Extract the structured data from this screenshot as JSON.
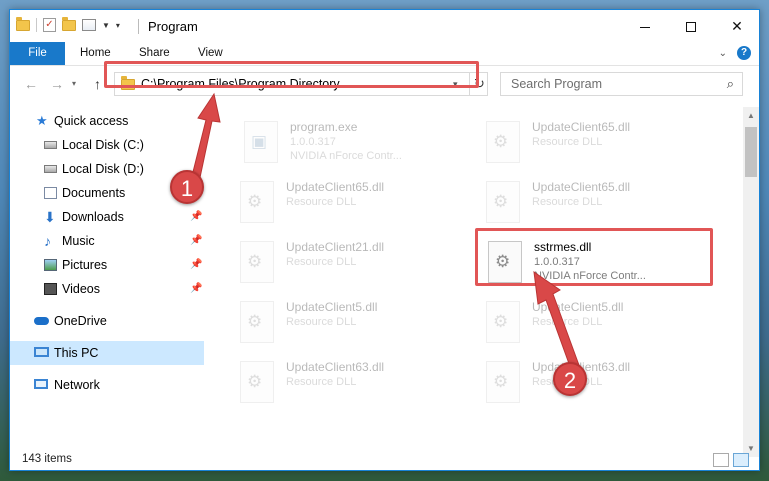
{
  "window": {
    "title": "Program",
    "buttons": {
      "minimize": "minimize",
      "maximize": "maximize",
      "close": "✕"
    }
  },
  "ribbon": {
    "tabs": [
      "File",
      "Home",
      "Share",
      "View"
    ]
  },
  "navigation": {
    "address": "C:\\Program Files\\Program Directory",
    "search_placeholder": "Search Program"
  },
  "sidebar": {
    "items": [
      {
        "label": "Quick access",
        "icon": "star-icon"
      },
      {
        "label": "Local Disk (C:)",
        "icon": "drive-icon"
      },
      {
        "label": "Local Disk (D:)",
        "icon": "drive-icon"
      },
      {
        "label": "Documents",
        "icon": "documents-icon"
      },
      {
        "label": "Downloads",
        "icon": "download-icon",
        "pinned": true
      },
      {
        "label": "Music",
        "icon": "music-icon",
        "pinned": true
      },
      {
        "label": "Pictures",
        "icon": "pictures-icon",
        "pinned": true
      },
      {
        "label": "Videos",
        "icon": "videos-icon",
        "pinned": true
      },
      {
        "label": "OneDrive",
        "icon": "cloud-icon"
      },
      {
        "label": "This PC",
        "icon": "computer-icon",
        "selected": true
      },
      {
        "label": "Network",
        "icon": "network-icon"
      }
    ]
  },
  "files": [
    {
      "name": "program.exe",
      "line1": "1.0.0.317",
      "line2": "NVIDIA nForce Contr..."
    },
    {
      "name": "UpdateClient65.dll",
      "line1": "Resource DLL"
    },
    {
      "name": "UpdateClient65.dll",
      "line1": "Resource DLL"
    },
    {
      "name": "UpdateClient65.dll",
      "line1": "Resource DLL"
    },
    {
      "name": "UpdateClient21.dll",
      "line1": "Resource DLL"
    },
    {
      "name": "sstrmes.dll",
      "line1": "1.0.0.317",
      "line2": "NVIDIA nForce Contr..."
    },
    {
      "name": "UpdateClient5.dll",
      "line1": "Resource DLL"
    },
    {
      "name": "UpdateClient5.dll",
      "line1": "Resource DLL"
    },
    {
      "name": "UpdateClient63.dll",
      "line1": "Resource DLL"
    },
    {
      "name": "UpdateClient63.dll",
      "line1": "Resource DLL"
    }
  ],
  "status": {
    "item_count": "143 items"
  },
  "annotations": {
    "step1": "1",
    "step2": "2",
    "color": "#d94848"
  }
}
